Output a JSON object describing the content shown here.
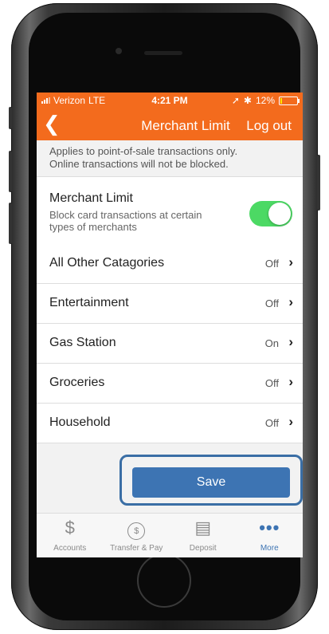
{
  "status": {
    "carrier": "Verizon",
    "network": "LTE",
    "time": "4:21 PM",
    "battery_pct": "12%",
    "battery_level": 0.12
  },
  "nav": {
    "back_icon": "chevron-left-icon",
    "title": "Merchant Limit",
    "logout": "Log out"
  },
  "info": {
    "line1": "Applies to point-of-sale transactions only.",
    "line2": "Online transactions will not be blocked."
  },
  "merchant_limit": {
    "title": "Merchant Limit",
    "subtitle_line1": "Block card transactions at certain",
    "subtitle_line2": "types of merchants",
    "enabled": true
  },
  "categories": [
    {
      "name": "All Other Catagories",
      "value": "Off"
    },
    {
      "name": "Entertainment",
      "value": "Off"
    },
    {
      "name": "Gas Station",
      "value": "On"
    },
    {
      "name": "Groceries",
      "value": "Off"
    },
    {
      "name": "Household",
      "value": "Off"
    }
  ],
  "save_label": "Save",
  "tabs": [
    {
      "label": "Accounts",
      "icon": "dollar-icon"
    },
    {
      "label": "Transfer & Pay",
      "icon": "transfer-icon"
    },
    {
      "label": "Deposit",
      "icon": "check-deposit-icon"
    },
    {
      "label": "More",
      "icon": "more-dots-icon"
    }
  ],
  "colors": {
    "brand_orange": "#f36b1d",
    "toggle_green": "#4cd964",
    "save_blue": "#3d74b3",
    "highlight_blue": "#3a6ea5"
  }
}
